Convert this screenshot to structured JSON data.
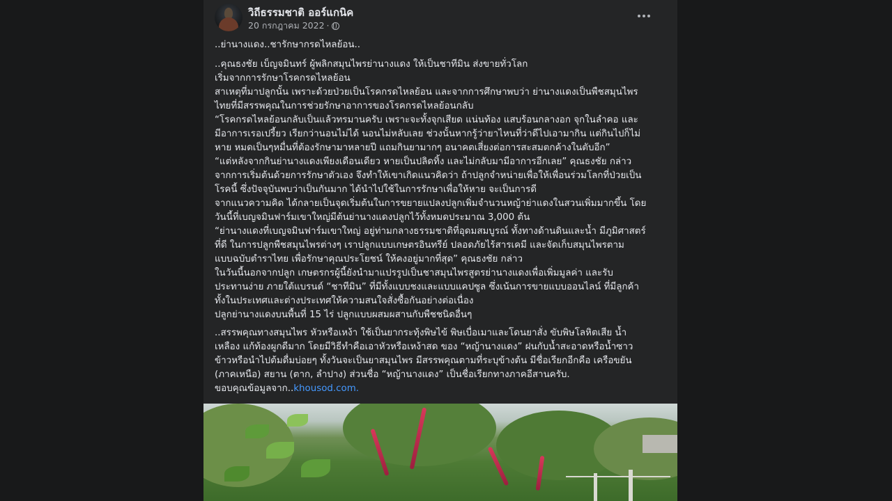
{
  "post": {
    "author": "วิถีธรรมชาติ ออร์แกนิค",
    "date": "20 กรกฎาคม 2022",
    "separator": "·",
    "privacy_icon": "globe-icon",
    "menu_icon": "more-horizontal-icon",
    "paragraphs": [
      "..ย่านางแดง..ชารักษากรดไหลย้อน..",
      "..คุณธงชัย เบ็ญจมินทร์ ผู้พลิกสมุนไพรย่านางแดง ให้เป็นชาทีมิน ส่งขายทั่วโลก",
      "เริ่มจากการรักษาโรคกรดไหลย้อน",
      "สาเหตุที่มาปลูกนั้น เพราะด้วยป่วยเป็นโรคกรดไหลย้อน และจากการศึกษาพบว่า ย่านางแดงเป็นพืชสมุนไพร",
      "ไทยที่มีสรรพคุณในการช่วยรักษาอาการของโรคกรดไหลย้อนกลับ",
      "“โรคกรดไหลย้อนกลับเป็นแล้วทรมานครับ เพราะจะทั้งจุกเสียด แน่นท้อง แสบร้อนกลางอก จุกในลำคอ และ",
      "มีอาการเรอเปรี้ยว เรียกว่านอนไม่ได้ นอนไม่หลับเลย ช่วงนั้นหากรู้ว่ายาไหนที่ว่าดีไปเอามากิน แต่กินไปก็ไม่",
      "หาย หมดเป็นๆหมื่นที่ต้องรักษามาหลายปี แถมกินยามากๆ อนาคตเสี่ยงต่อการสะสมตกค้างในตับอีก”",
      "“แต่หลังจากกินย่านางแดงเพียงเดือนเดียว หายเป็นปลิดทิ้ง และไม่กลับมามีอาการอีกเลย” คุณธงชัย กล่าว",
      "จากการเริ่มต้นด้วยการรักษาตัวเอง จึงทำให้เขาเกิดแนวคิดว่า ถ้าปลูกจำหน่ายเพื่อให้เพื่อนร่วมโลกที่ป่วยเป็น",
      "โรคนี้ ซึ่งปัจจุบันพบว่าเป็นกันมาก ได้นำไปใช้ในการรักษาเพื่อให้หาย จะเป็นการดี",
      "จากแนวความคิด ได้กลายเป็นจุดเริ่มต้นในการขยายแปลงปลูกเพิ่มจำนวนหญ้าย่าแดงในสวนเพิ่มมากขึ้น โดย",
      "วันนี้ที่เบญจมินฟาร์มเขาใหญ่มีต้นย่านางแดงปลูกไว้ทั้งหมดประมาณ 3,000 ต้น",
      "“ย่านางแดงที่เบญจมินฟาร์มเขาใหญ่ อยู่ท่ามกลางธรรมชาติที่อุดมสมบูรณ์ ทั้งทางด้านดินและน้ำ มีภูมิศาสตร์",
      "ที่ดี ในการปลูกพืชสมุนไพรต่างๆ เราปลูกแบบเกษตรอินทรีย์ ปลอดภัยไร้สารเคมี และจัดเก็บสมุนไพรตาม",
      "แบบฉบับตำราไทย เพื่อรักษาคุณประโยชน์ ให้คงอยู่มากที่สุด” คุณธงชัย กล่าว",
      "ในวันนี้นอกจากปลูก เกษตรกรผู้นี้ยังนำมาแปรรูปเป็นชาสมุนไพรสูตรย่านางแดงเพื่อเพิ่มมูลค่า และรับ",
      "ประทานง่าย ภายใต้แบรนด์ “ชาทีมิน” ที่มีทั้งแบบชงและแบบแคปซูล ซึ่งเน้นการขายแบบออนไลน์ ที่มีลูกค้า",
      "ทั้งในประเทศและต่างประเทศให้ความสนใจสั่งซื้อกันอย่างต่อเนื่อง",
      "ปลูกย่านางแดงบนพื้นที่ 15 ไร่ ปลูกแบบผสมผสานกับพืชชนิดอื่นๆ",
      "..สรรพคุณทางสมุนไพร หัวหรือเหง้า ใช้เป็นยากระทุ้งพิษไข้ พิษเบื่อเมาและโดนยาสั่ง ขับพิษโลหิตเสีย น้ำ",
      "เหลือง แก้ท้องผูกดีมาก โดยมีวิธีทำคือเอาหัวหรือเหง้าสด ของ “หญ้านางแดง” ฝนกับน้ำสะอาดหรือน้ำซาว",
      "ข้าวหรือนำไปต้มดื่มบ่อยๆ ทั้งวันจะเป็นยาสมุนไพร มีสรรพคุณตามที่ระบุข้างต้น มีชื่อเรียกอีกคือ เครือขยัน",
      "(ภาคเหนือ) สยาน (ตาก, ลำปาง) ส่วนชื่อ “หญ้านางแดง” เป็นชื่อเรียกทางภาคอีสานครับ.",
      "ขอบคุณข้อมูลจาก.."
    ],
    "source_link": "khousod.com."
  },
  "colors": {
    "page_bg": "#18191a",
    "card_bg": "#242526",
    "text": "#e4e6eb",
    "secondary_text": "#b0b3b8",
    "link": "#4599ff"
  }
}
